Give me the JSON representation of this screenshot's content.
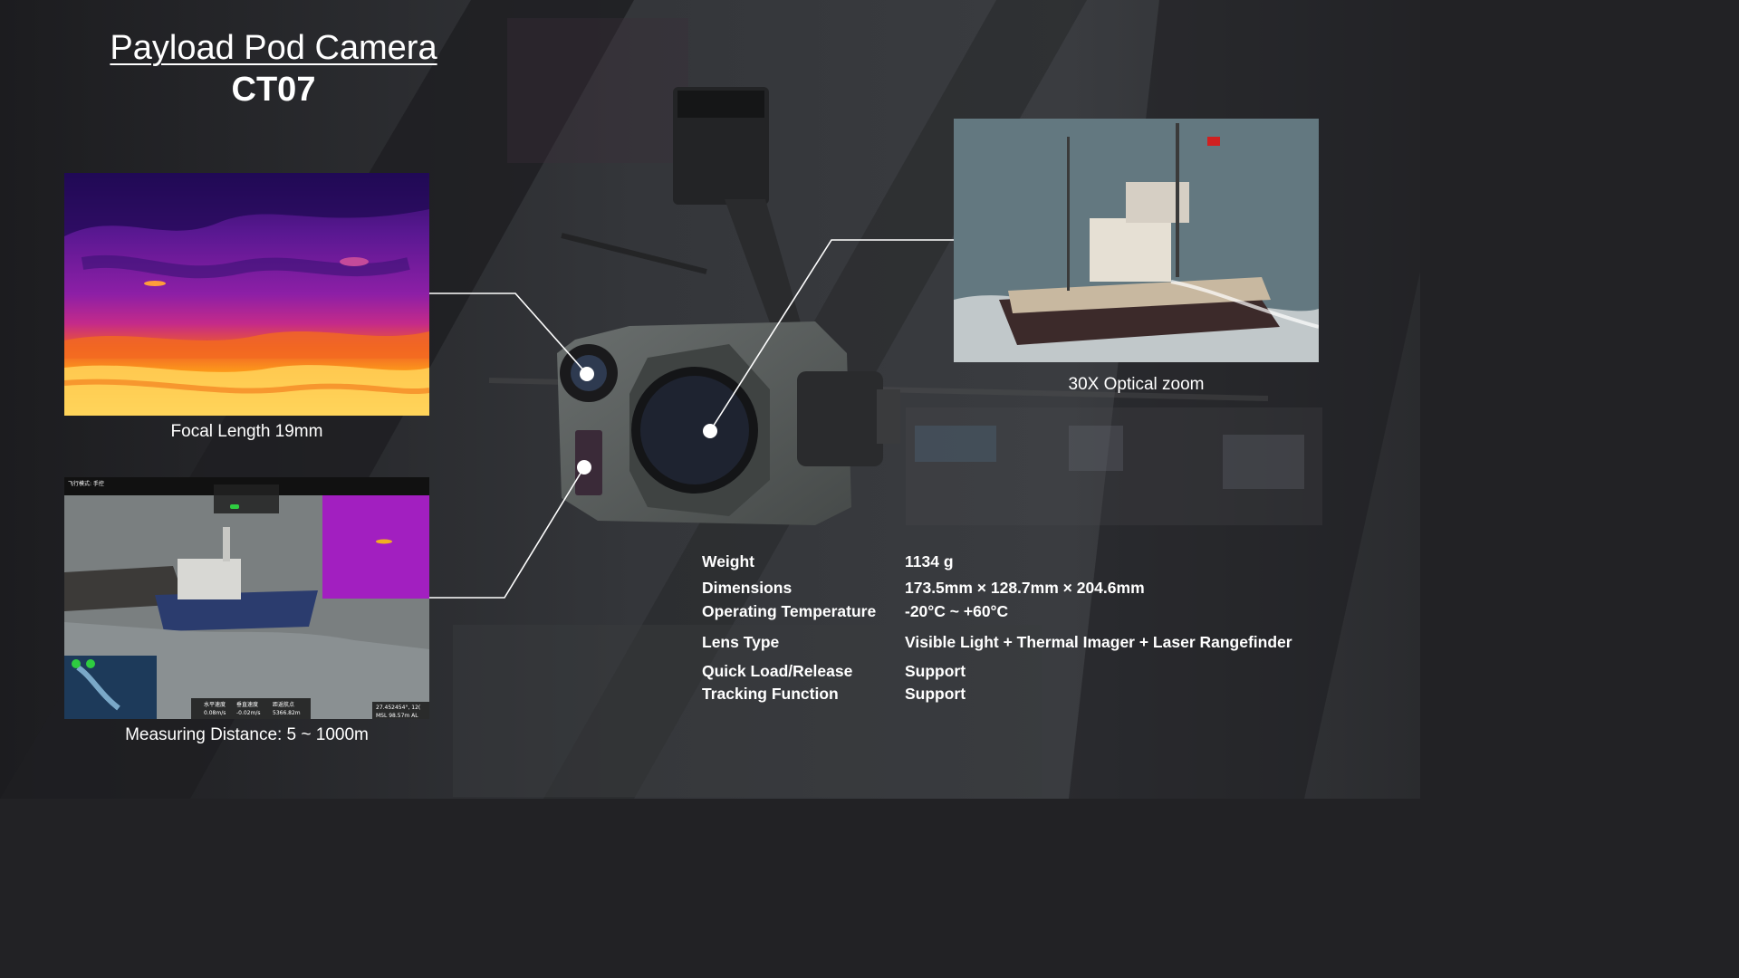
{
  "header": {
    "title": "Payload Pod Camera",
    "model": "CT07"
  },
  "images": {
    "thermal": {
      "caption": "Focal Length 19mm"
    },
    "ranging": {
      "caption": "Measuring Distance: 5 ~ 1000m",
      "osd": {
        "flight_mode": "飞行模式: 手控",
        "horizontal_speed_label": "水平速度",
        "horizontal_speed": "0.08m/s",
        "vertical_speed_label": "垂直速度",
        "vertical_speed": "-0.02m/s",
        "home_distance_label": "距返航点",
        "home_distance": "5366.82m",
        "coordinates": "27.452454°, 12(",
        "msl": "MSL  98.57m  AL"
      }
    },
    "zoom": {
      "caption": "30X  Optical zoom"
    }
  },
  "specs": [
    {
      "label": "Weight",
      "value": "1134 g"
    },
    {
      "label": "Dimensions",
      "value": "173.5mm × 128.7mm × 204.6mm"
    },
    {
      "label": "Operating Temperature",
      "value": "-20°C ~ +60°C"
    },
    {
      "label": "Lens Type",
      "value": "Visible Light + Thermal Imager + Laser Rangefinder"
    },
    {
      "label": "Quick Load/Release",
      "value": "Support"
    },
    {
      "label": "Tracking Function",
      "value": "Support"
    }
  ],
  "colors": {
    "background": "#222225",
    "text": "#ffffff",
    "connector": "#ffffff",
    "camera_body": "#5a5f5e"
  }
}
